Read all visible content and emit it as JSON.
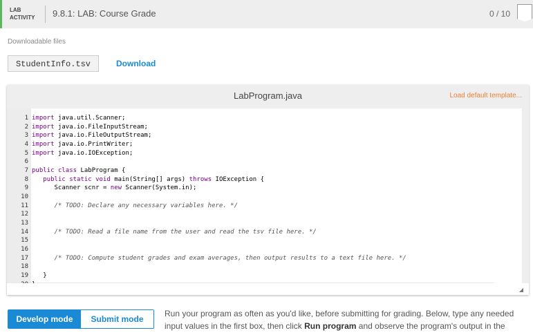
{
  "header": {
    "lab_line1": "LAB",
    "lab_line2": "ACTIVITY",
    "title": "9.8.1: LAB: Course Grade",
    "score": "0 / 10"
  },
  "downloads": {
    "label": "Downloadable files",
    "file": "StudentInfo.tsv",
    "download": "Download"
  },
  "editor": {
    "filename": "LabProgram.java",
    "load_default": "Load default template...",
    "lines": [
      "import java.util.Scanner;",
      "import java.io.FileInputStream;",
      "import java.io.FileOutputStream;",
      "import java.io.PrintWriter;",
      "import java.io.IOException;",
      "",
      "public class LabProgram {",
      "   public static void main(String[] args) throws IOException {",
      "      Scanner scnr = new Scanner(System.in);",
      "",
      "      /* TODO: Declare any necessary variables here. */",
      "",
      "",
      "      /* TODO: Read a file name from the user and read the tsv file here. */",
      "",
      "",
      "      /* TODO: Compute student grades and exam averages, then output results to a text file here. */",
      "",
      "   }",
      "}"
    ]
  },
  "modes": {
    "develop": "Develop mode",
    "submit": "Submit mode"
  },
  "description": {
    "part1": "Run your program as often as you'd like, before submitting for grading. Below, type any needed input values in the first box, then click ",
    "bold": "Run program",
    "part2": " and observe the program's output in the"
  }
}
